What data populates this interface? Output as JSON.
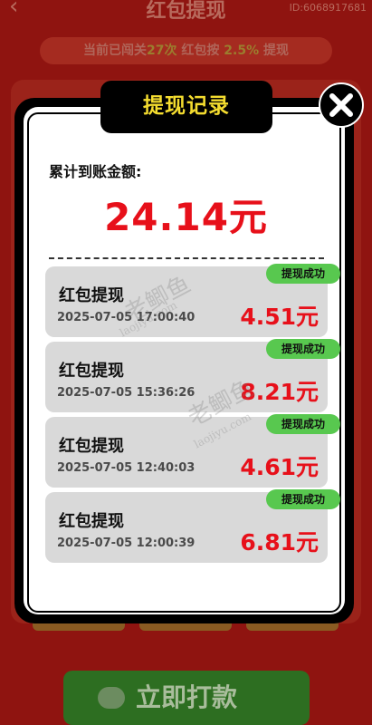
{
  "background": {
    "page_title": "红包提现",
    "user_id": "ID:6068917681",
    "info_prefix": "当前已闯关",
    "info_count": "27次",
    "info_mid": " 红包按 ",
    "info_rate": "2.5%",
    "info_suffix": " 提现",
    "cta_label": "立即打款"
  },
  "modal": {
    "title": "提现记录",
    "total_label": "累计到账金额:",
    "total_value": "24.14元",
    "records": [
      {
        "title": "红包提现",
        "time": "2025-07-05 17:00:40",
        "amount": "4.51元",
        "status": "提现成功"
      },
      {
        "title": "红包提现",
        "time": "2025-07-05 15:36:26",
        "amount": "8.21元",
        "status": "提现成功"
      },
      {
        "title": "红包提现",
        "time": "2025-07-05 12:40:03",
        "amount": "4.61元",
        "status": "提现成功"
      },
      {
        "title": "红包提现",
        "time": "2025-07-05 12:00:39",
        "amount": "6.81元",
        "status": "提现成功"
      }
    ]
  },
  "watermark": {
    "cn": "老鲫鱼",
    "en": "laojiyu.com"
  },
  "colors": {
    "accent_red": "#e7101a",
    "title_yellow": "#f4dc2f",
    "success_green": "#58c84f",
    "card_gray": "#d9d9d9"
  }
}
